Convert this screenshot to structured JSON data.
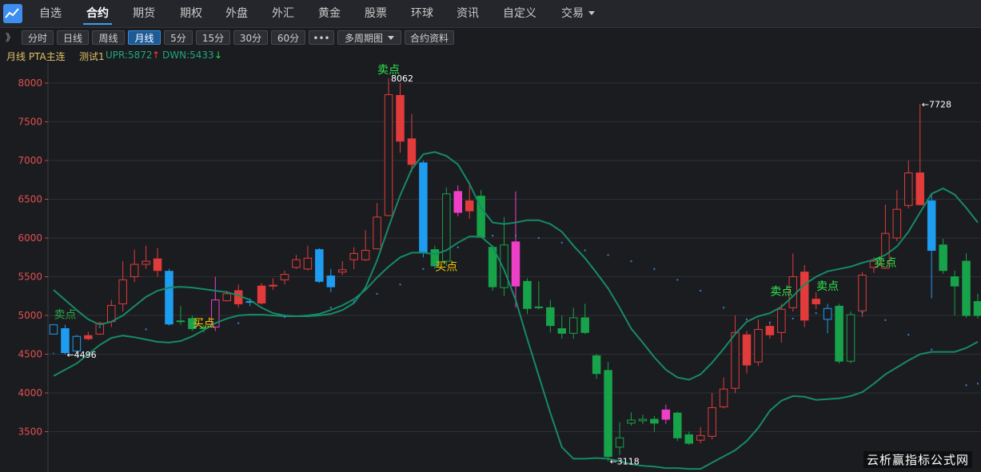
{
  "nav": {
    "items": [
      {
        "label": "自选"
      },
      {
        "label": "合约"
      },
      {
        "label": "期货"
      },
      {
        "label": "期权"
      },
      {
        "label": "外盘"
      },
      {
        "label": "外汇"
      },
      {
        "label": "黄金"
      },
      {
        "label": "股票"
      },
      {
        "label": "环球"
      },
      {
        "label": "资讯"
      },
      {
        "label": "自定义"
      },
      {
        "label": "交易"
      }
    ],
    "active": "合约"
  },
  "toolbar": {
    "expand": "》",
    "periods": [
      "分时",
      "日线",
      "周线",
      "月线",
      "5分",
      "15分",
      "30分",
      "60分"
    ],
    "active_period": "月线",
    "more": "•••",
    "multi_period": "多周期图",
    "contract_info": "合约资料"
  },
  "info": {
    "period_contract": "月线 PTA主连",
    "indicator_name": "测试1",
    "upr": "UPR:5872",
    "dwn": "DWN:5433",
    "up_arrow": "↑",
    "down_arrow": "↓"
  },
  "chart_data": {
    "type": "candlestick",
    "y_ticks": [
      "8000",
      "7500",
      "7000",
      "6500",
      "6000",
      "5500",
      "5000",
      "4500",
      "4000",
      "3500"
    ],
    "ylim": [
      3000,
      8300
    ],
    "grid": true,
    "candles": [
      [
        4760,
        4880,
        4520,
        4500,
        "up",
        "blue"
      ],
      [
        4830,
        4520,
        4880,
        4496,
        "down",
        "blue"
      ],
      [
        4540,
        4730,
        4750,
        4500,
        "up",
        "blue"
      ],
      [
        4740,
        4700,
        4790,
        4680,
        "down",
        "red"
      ],
      [
        4760,
        4900,
        4920,
        4750,
        "up",
        "red"
      ],
      [
        4920,
        5130,
        5200,
        4850,
        "up",
        "red"
      ],
      [
        5150,
        5460,
        5700,
        5050,
        "up",
        "red"
      ],
      [
        5500,
        5660,
        5850,
        5430,
        "up",
        "red"
      ],
      [
        5660,
        5700,
        5900,
        5600,
        "up",
        "red"
      ],
      [
        5730,
        5580,
        5870,
        5500,
        "down",
        "red"
      ],
      [
        5570,
        4890,
        5600,
        4870,
        "down",
        "blue"
      ],
      [
        4930,
        4920,
        5120,
        4880,
        "down",
        "green"
      ],
      [
        4960,
        4830,
        5000,
        4800,
        "down",
        "green"
      ],
      [
        4840,
        4830,
        4880,
        4780,
        "down",
        "green"
      ],
      [
        4850,
        5200,
        5500,
        4800,
        "up",
        "magenta"
      ],
      [
        5190,
        5280,
        5320,
        5180,
        "up",
        "red"
      ],
      [
        5320,
        5150,
        5400,
        5100,
        "down",
        "red"
      ],
      [
        5180,
        5180,
        5220,
        5120,
        "down",
        "blue"
      ],
      [
        5380,
        5160,
        5420,
        5140,
        "down",
        "red"
      ],
      [
        5380,
        5390,
        5480,
        5330,
        "up",
        "red"
      ],
      [
        5460,
        5530,
        5580,
        5400,
        "up",
        "red"
      ],
      [
        5620,
        5720,
        5780,
        5600,
        "up",
        "red"
      ],
      [
        5600,
        5740,
        5900,
        5580,
        "up",
        "red"
      ],
      [
        5850,
        5440,
        5870,
        5420,
        "down",
        "blue"
      ],
      [
        5510,
        5370,
        5600,
        5300,
        "down",
        "blue"
      ],
      [
        5560,
        5590,
        5700,
        5520,
        "up",
        "red"
      ],
      [
        5720,
        5800,
        5880,
        5600,
        "up",
        "red"
      ],
      [
        5720,
        5840,
        6100,
        5700,
        "up",
        "red"
      ],
      [
        5860,
        6270,
        6450,
        5850,
        "up",
        "red"
      ],
      [
        6290,
        7850,
        8062,
        6280,
        "up",
        "red"
      ],
      [
        7840,
        7250,
        8000,
        7100,
        "down",
        "red"
      ],
      [
        7280,
        6950,
        7600,
        6850,
        "down",
        "red"
      ],
      [
        6970,
        5820,
        7000,
        5750,
        "down",
        "blue"
      ],
      [
        5850,
        5640,
        5900,
        5600,
        "down",
        "green"
      ],
      [
        5700,
        6570,
        6650,
        5640,
        "up",
        "green"
      ],
      [
        6600,
        6330,
        6680,
        6280,
        "down",
        "magenta"
      ],
      [
        6480,
        6350,
        6720,
        6250,
        "down",
        "red"
      ],
      [
        6540,
        6010,
        6620,
        6000,
        "down",
        "green"
      ],
      [
        5880,
        5370,
        5910,
        5320,
        "down",
        "green"
      ],
      [
        5360,
        5910,
        6270,
        5250,
        "up",
        "green"
      ],
      [
        5950,
        5380,
        6600,
        5100,
        "down",
        "magenta"
      ],
      [
        5440,
        5090,
        5480,
        5020,
        "down",
        "green"
      ],
      [
        5110,
        5110,
        5440,
        5080,
        "down",
        "green"
      ],
      [
        5100,
        4870,
        5200,
        4780,
        "down",
        "green"
      ],
      [
        4830,
        4770,
        5000,
        4700,
        "down",
        "green"
      ],
      [
        4770,
        4970,
        5100,
        4700,
        "up",
        "green"
      ],
      [
        4970,
        4780,
        5150,
        4760,
        "down",
        "green"
      ],
      [
        4480,
        4250,
        4500,
        4180,
        "down",
        "green"
      ],
      [
        4290,
        3180,
        4400,
        3118,
        "down",
        "green"
      ],
      [
        3300,
        3420,
        3620,
        3200,
        "up",
        "green"
      ],
      [
        3610,
        3650,
        3750,
        3580,
        "up",
        "green"
      ],
      [
        3640,
        3660,
        3720,
        3600,
        "up",
        "green"
      ],
      [
        3660,
        3610,
        3700,
        3500,
        "down",
        "green"
      ],
      [
        3780,
        3660,
        3850,
        3600,
        "down",
        "magenta"
      ],
      [
        3740,
        3420,
        3760,
        3380,
        "down",
        "green"
      ],
      [
        3460,
        3350,
        3500,
        3330,
        "down",
        "green"
      ],
      [
        3390,
        3450,
        3560,
        3350,
        "up",
        "red"
      ],
      [
        3440,
        3810,
        4000,
        3400,
        "up",
        "red"
      ],
      [
        3820,
        4050,
        4200,
        3800,
        "up",
        "red"
      ],
      [
        4060,
        4780,
        5000,
        4000,
        "up",
        "red"
      ],
      [
        4750,
        4360,
        4800,
        4250,
        "down",
        "red"
      ],
      [
        4400,
        4820,
        4950,
        4350,
        "up",
        "red"
      ],
      [
        4860,
        4750,
        4900,
        4700,
        "down",
        "red"
      ],
      [
        4780,
        5080,
        5150,
        4650,
        "up",
        "red"
      ],
      [
        5100,
        5500,
        5800,
        5050,
        "up",
        "red"
      ],
      [
        5560,
        4940,
        5650,
        4850,
        "down",
        "red"
      ],
      [
        5210,
        5150,
        5300,
        5080,
        "down",
        "red"
      ],
      [
        4950,
        5090,
        5150,
        4770,
        "up",
        "blue"
      ],
      [
        5120,
        4410,
        5150,
        4380,
        "down",
        "green"
      ],
      [
        4410,
        5010,
        5050,
        4380,
        "up",
        "green"
      ],
      [
        5060,
        5520,
        5560,
        4980,
        "up",
        "red"
      ],
      [
        5620,
        5700,
        5750,
        5550,
        "up",
        "red"
      ],
      [
        5610,
        6060,
        6430,
        5600,
        "up",
        "red"
      ],
      [
        6000,
        6370,
        6620,
        5960,
        "up",
        "red"
      ],
      [
        6420,
        6840,
        7000,
        6380,
        "up",
        "red"
      ],
      [
        6840,
        6430,
        7728,
        6420,
        "down",
        "red"
      ],
      [
        6480,
        5840,
        6560,
        5220,
        "down",
        "blue"
      ],
      [
        5910,
        5580,
        5990,
        5540,
        "down",
        "green"
      ],
      [
        5500,
        5380,
        5580,
        5000,
        "down",
        "green"
      ],
      [
        5700,
        5000,
        5800,
        4970,
        "down",
        "green"
      ],
      [
        5180,
        5000,
        5280,
        4960,
        "down",
        "green"
      ]
    ],
    "annotations": [
      {
        "text": "卖点",
        "index": 29,
        "value": 8062,
        "color": "#2ee84e"
      },
      {
        "text": "8062",
        "index": 29,
        "value": 8062,
        "color": "#ffffff"
      },
      {
        "text": "←7728",
        "index": 75,
        "value": 7728,
        "color": "#ffffff"
      },
      {
        "text": "←4496",
        "index": 1,
        "value": 4496,
        "color": "#ffffff"
      },
      {
        "text": "←3118",
        "index": 48,
        "value": 3118,
        "color": "#ffffff"
      },
      {
        "text": "卖点",
        "index": 1,
        "value": 4900,
        "color": "#2aa84a"
      },
      {
        "text": "买点",
        "index": 13,
        "value": 4790,
        "color": "#f5c800"
      },
      {
        "text": "买点",
        "index": 34,
        "value": 5520,
        "color": "#f5c800"
      },
      {
        "text": "卖点",
        "index": 63,
        "value": 5200,
        "color": "#2ee84e"
      },
      {
        "text": "卖点",
        "index": 67,
        "value": 5270,
        "color": "#2ee84e"
      },
      {
        "text": "卖点",
        "index": 72,
        "value": 5570,
        "color": "#2ee84e"
      }
    ],
    "upper_line": [
      5330,
      5200,
      5070,
      4950,
      4880,
      4920,
      5000,
      5120,
      5240,
      5320,
      5360,
      5370,
      5360,
      5340,
      5320,
      5300,
      5260,
      5200,
      5100,
      5030,
      5000,
      4990,
      4990,
      5000,
      5020,
      5070,
      5160,
      5360,
      5710,
      6140,
      6550,
      6890,
      7080,
      7110,
      7060,
      6950,
      6700,
      6390,
      6200,
      6180,
      6200,
      6230,
      6230,
      6180,
      6080,
      5900,
      5740,
      5550,
      5350,
      5100,
      4830,
      4650,
      4460,
      4300,
      4200,
      4170,
      4240,
      4390,
      4570,
      4760,
      4920,
      4990,
      5030,
      5110,
      5250,
      5400,
      5500,
      5570,
      5600,
      5630,
      5680,
      5720,
      5780,
      5890,
      6080,
      6330,
      6570,
      6640,
      6560,
      6390,
      6200
    ],
    "lower_line": [
      4220,
      4300,
      4380,
      4500,
      4620,
      4710,
      4740,
      4720,
      4690,
      4660,
      4650,
      4670,
      4730,
      4810,
      4900,
      4960,
      5000,
      5010,
      5010,
      5000,
      4990,
      4990,
      5000,
      5020,
      5070,
      5130,
      5210,
      5330,
      5490,
      5630,
      5750,
      5810,
      5810,
      5790,
      5840,
      5940,
      6020,
      6020,
      5890,
      5590,
      5200,
      4700,
      4220,
      3740,
      3300,
      3150,
      3150,
      3160,
      3150,
      3120,
      3080,
      3060,
      3050,
      3030,
      3030,
      3020,
      3020,
      3100,
      3180,
      3260,
      3380,
      3550,
      3770,
      3900,
      3960,
      3950,
      3910,
      3920,
      3930,
      3960,
      4010,
      4120,
      4240,
      4330,
      4420,
      4500,
      4530,
      4530,
      4530,
      4580,
      4660
    ],
    "dots": [
      [
        4,
        4850
      ],
      [
        8,
        4820
      ],
      [
        12,
        4870
      ],
      [
        16,
        4900
      ],
      [
        20,
        4980
      ],
      [
        24,
        5100
      ],
      [
        26,
        5180
      ],
      [
        28,
        5280
      ],
      [
        30,
        5400
      ],
      [
        32,
        5600
      ],
      [
        33,
        5650
      ],
      [
        35,
        5880
      ],
      [
        38,
        6030
      ],
      [
        40,
        6030
      ],
      [
        42,
        6000
      ],
      [
        44,
        5940
      ],
      [
        46,
        5840
      ],
      [
        48,
        5780
      ],
      [
        50,
        5700
      ],
      [
        52,
        5600
      ],
      [
        54,
        5460
      ],
      [
        56,
        5320
      ],
      [
        58,
        5100
      ],
      [
        60,
        4950
      ],
      [
        62,
        4910
      ],
      [
        64,
        4960
      ],
      [
        66,
        5030
      ],
      [
        68,
        5090
      ],
      [
        70,
        5040
      ],
      [
        72,
        4940
      ],
      [
        74,
        4750
      ],
      [
        76,
        4560
      ],
      [
        79,
        4100
      ],
      [
        80,
        4120
      ]
    ]
  }
}
